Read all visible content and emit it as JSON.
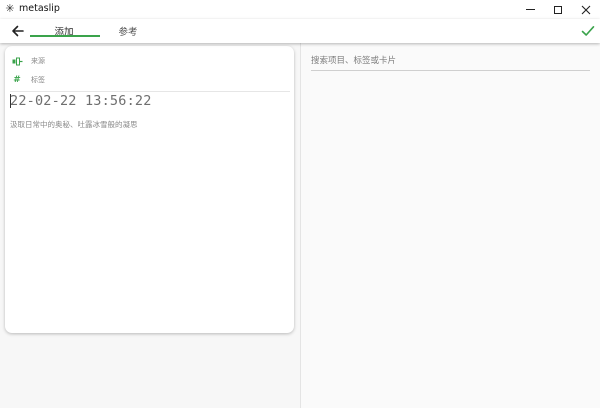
{
  "window": {
    "title": "metaslip",
    "app_icon_glyph": "✳"
  },
  "toolbar": {
    "back_icon": "arrow-left-icon",
    "tabs": [
      {
        "label": "添加",
        "active": true
      },
      {
        "label": "参考",
        "active": false
      }
    ],
    "confirm_icon": "check-icon"
  },
  "editor": {
    "source_label": "来源",
    "tags_label": "标签",
    "tags_glyph": "#",
    "timestamp": "22-02-22 13:56:22",
    "content": "汲取日常中的奥秘、吐露冰雪般的凝思"
  },
  "search": {
    "placeholder": "搜索项目、标签或卡片",
    "value": ""
  },
  "colors": {
    "accent": "#3aa34b",
    "muted_text": "#8a8a8a"
  }
}
